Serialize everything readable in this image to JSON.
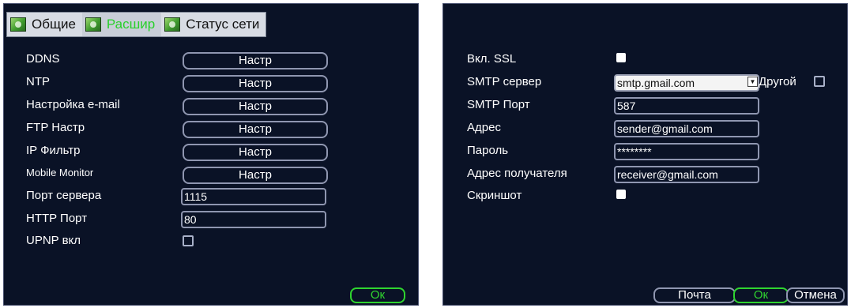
{
  "tabs": [
    {
      "label": "Общие",
      "active": false
    },
    {
      "label": "Расшир",
      "active": true
    },
    {
      "label": "Статус сети",
      "active": false
    }
  ],
  "left": {
    "rows": [
      {
        "label": "DDNS",
        "button": "Настр"
      },
      {
        "label": "NTP",
        "button": "Настр"
      },
      {
        "label": "Настройка e-mail",
        "button": "Настр"
      },
      {
        "label": "FTP Настр",
        "button": "Настр"
      },
      {
        "label": "IP Фильтр",
        "button": "Настр"
      },
      {
        "label": "Mobile Monitor",
        "button": "Настр"
      }
    ],
    "server_port_label": "Порт сервера",
    "server_port_value": "1115",
    "http_port_label": "HTTP Порт",
    "http_port_value": "80",
    "upnp_label": "UPNP вкл",
    "ok_label": "Ок"
  },
  "right": {
    "ssl_label": "Вкл. SSL",
    "smtp_server_label": "SMTP сервер",
    "smtp_server_value": "smtp.gmail.com",
    "other_label": "Другой",
    "smtp_port_label": "SMTP Порт",
    "smtp_port_value": "587",
    "address_label": "Адрес",
    "address_value": "sender@gmail.com",
    "password_label": "Пароль",
    "password_value": "********",
    "recipient_label": "Адрес получателя",
    "recipient_value": "receiver@gmail.com",
    "screenshot_label": "Скриншот",
    "mail_button": "Почта",
    "ok_button": "Ок",
    "cancel_button": "Отмена"
  },
  "colors": {
    "panel_bg": "#0a1226",
    "active_tab": "#28d02a",
    "ok_green": "#2fd42f"
  }
}
